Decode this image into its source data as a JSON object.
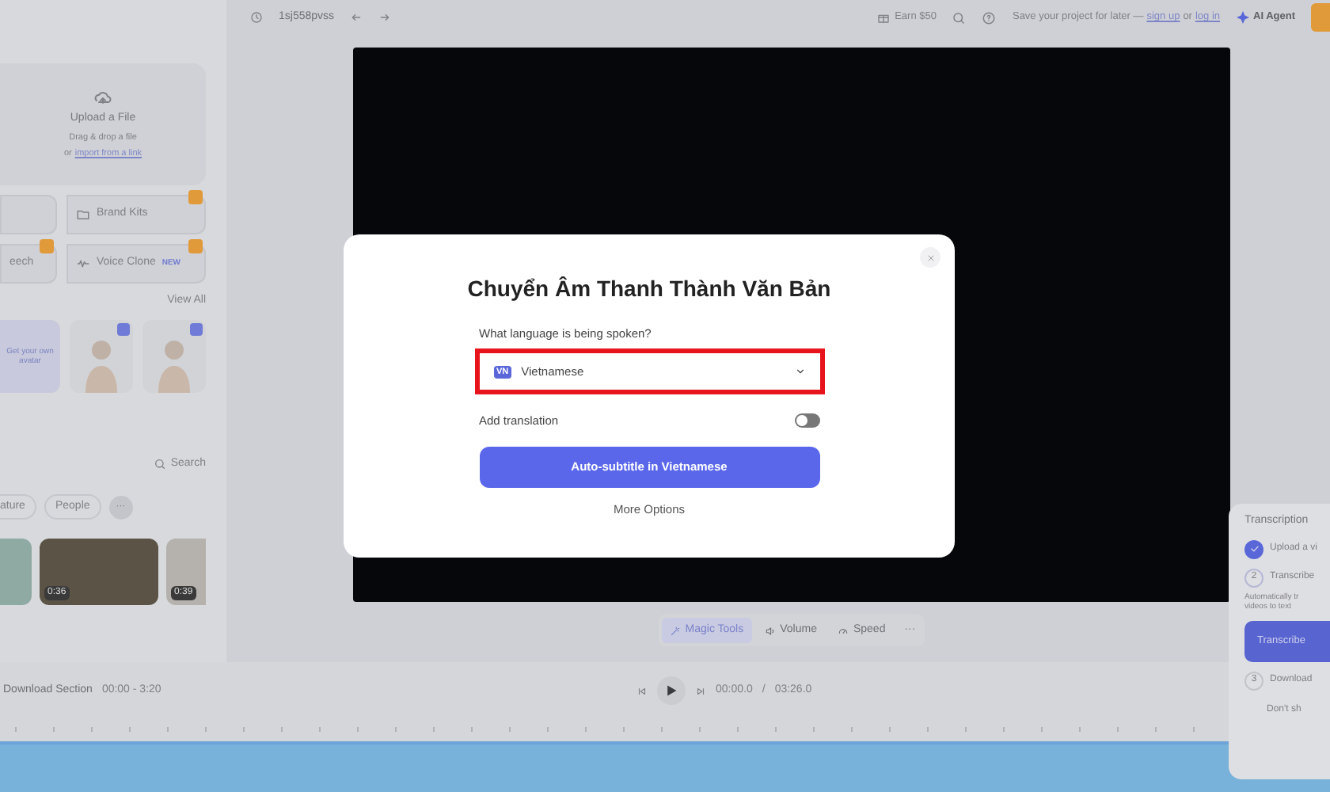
{
  "top_bar": {
    "project_name": "1sj558pvss",
    "earn": "Earn $50",
    "save_text": "Save your project for later —",
    "sign_up": "sign up",
    "or": "or",
    "log_in": "log in",
    "ai_agent": "AI Agent"
  },
  "sidebar": {
    "upload": {
      "title": "Upload a File",
      "hint": "Drag & drop a file",
      "or": "or",
      "link": "import from a link"
    },
    "tools": [
      {
        "pro": false
      },
      {
        "label": "Brand Kits",
        "pro": true
      },
      {
        "label": "eech",
        "pro": true
      },
      {
        "label": "Voice Clone",
        "pro": true,
        "badge": "NEW"
      }
    ],
    "view_all": "View All",
    "avatar_cta": "Get your own avatar",
    "avatars": [
      {
        "pro": true
      },
      {
        "pro": true
      }
    ],
    "search": "Search",
    "chips": [
      "ature",
      "People"
    ],
    "more": "···",
    "videos": [
      {
        "kind": "coast"
      },
      {
        "kind": "forest",
        "duration": "0:36"
      },
      {
        "kind": "beach",
        "duration": "0:39"
      }
    ]
  },
  "toolbar": [
    {
      "label": "Magic Tools",
      "selected": true
    },
    {
      "label": "Volume",
      "selected": false
    },
    {
      "label": "Speed",
      "selected": false
    }
  ],
  "toolbar_more": "···",
  "timeline": {
    "section": "Download Section",
    "range": "00:00 - 3:20",
    "current": "00:00.0",
    "separator": "/",
    "total": "03:26.0"
  },
  "transcription_panel": {
    "title": "Transcription",
    "steps": [
      {
        "label": "Upload a vi",
        "done": true
      },
      {
        "number": "2",
        "label": "Transcribe",
        "done": false,
        "description": "Automatically tr videos to text"
      },
      {
        "number": "3",
        "label": "Download",
        "done": false
      }
    ],
    "button": "Transcribe",
    "footer": "Don't sh"
  },
  "dialog": {
    "title": "Chuyển Âm Thanh Thành Văn Bản",
    "question": "What language is being spoken?",
    "language": {
      "code": "VN",
      "name": "Vietnamese"
    },
    "highlighted": true,
    "translation": {
      "label": "Add translation",
      "on": false
    },
    "submit": "Auto-subtitle in Vietnamese",
    "more": "More Options"
  }
}
